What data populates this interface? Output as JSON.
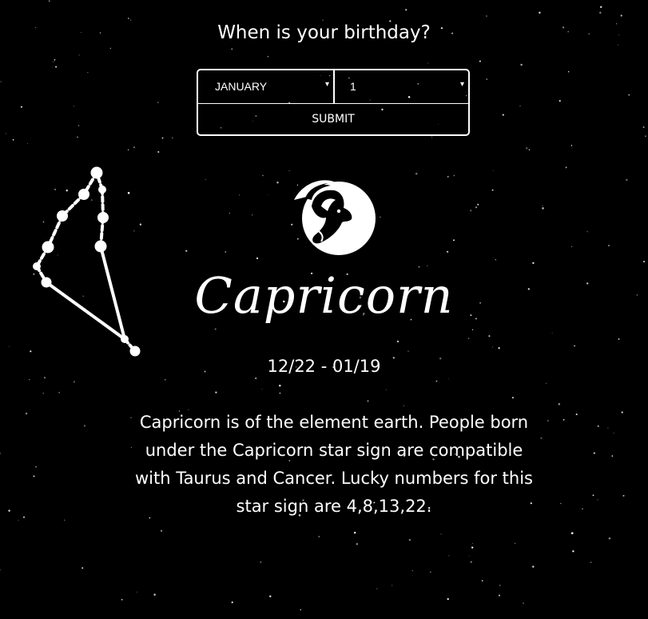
{
  "page": {
    "background": "#000000",
    "text_color": "#ffffff"
  },
  "form": {
    "question": "When is your birthday?",
    "month_value": "JANUARY",
    "day_value": "1",
    "submit_label": "SUBMIT",
    "dropdown_arrow": "▾"
  },
  "sign": {
    "icon": "capricorn-goat-icon",
    "name": "Capricorn",
    "dates": "12/22 - 01/19",
    "description": "Capricorn is of the element earth. People born under the Capricorn star sign are compatible with Taurus and Cancer. Lucky numbers for this star sign are 4,8,13,22."
  }
}
